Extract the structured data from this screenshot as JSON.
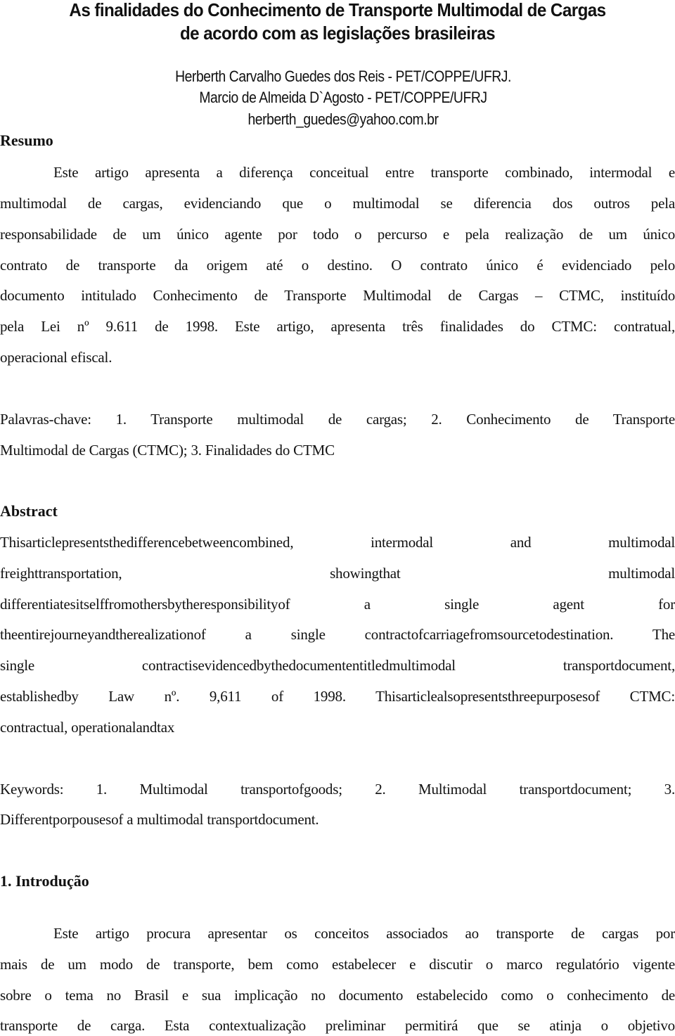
{
  "title": {
    "line1": "As finalidades do Conhecimento de Transporte Multimodal de Cargas",
    "line2": "de acordo com as legislações brasileiras"
  },
  "authors": {
    "line1": "Herberth Carvalho Guedes dos Reis - PET/COPPE/UFRJ.",
    "line2": "Marcio de Almeida D`Agosto - PET/COPPE/UFRJ",
    "email": "herberth_guedes@yahoo.com.br"
  },
  "resumo": {
    "heading": "Resumo",
    "lines": [
      "Este artigo apresenta a diferença conceitual entre transporte combinado, intermodal e",
      "multimodal de cargas, evidenciando que o multimodal se diferencia dos outros pela",
      "responsabilidade de um único agente por todo o percurso e pela realização de um único",
      "contrato de transporte da origem até o destino. O contrato único é evidenciado pelo",
      "documento intitulado Conhecimento de Transporte Multimodal de Cargas – CTMC, instituído",
      "pela Lei nº 9.611 de 1998. Este artigo, apresenta três finalidades do CTMC: contratual,",
      "operacional efiscal."
    ]
  },
  "palavras_chave": {
    "lines": [
      "Palavras-chave: 1. Transporte multimodal de cargas; 2. Conhecimento de Transporte",
      "Multimodal de Cargas (CTMC); 3. Finalidades do CTMC"
    ]
  },
  "abstract": {
    "heading": "Abstract",
    "lines": [
      "Thisarticlepresentsthedifferencebetweencombined, intermodal and multimodal",
      "freighttransportation, showingthat multimodal",
      "differentiatesitselffromothersbytheresponsibilityof a single agent for",
      "theentirejourneyandtherealizationof a single contractofcarriagefromsourcetodestination. The",
      "single contractisevidencedbythedocumententitledmultimodal transportdocument,",
      "establishedby Law nº. 9,611 of 1998. Thisarticlealsopresentsthreepurposesof CTMC:",
      "contractual, operationalandtax"
    ]
  },
  "keywords": {
    "lines": [
      "Keywords: 1. Multimodal transportofgoods; 2. Multimodal transportdocument; 3.",
      "Differentporpousesof a multimodal transportdocument."
    ]
  },
  "introducao": {
    "heading": "1. Introdução",
    "lines": [
      "Este artigo procura apresentar os conceitos associados ao transporte de cargas por",
      "mais de um modo de transporte, bem como estabelecer e discutir o marco regulatório vigente",
      "sobre o tema no Brasil e sua implicação no documento estabelecido como o conhecimento de",
      "transporte de carga. Esta contextualização preliminar permitirá que se atinja o objetivo"
    ]
  }
}
